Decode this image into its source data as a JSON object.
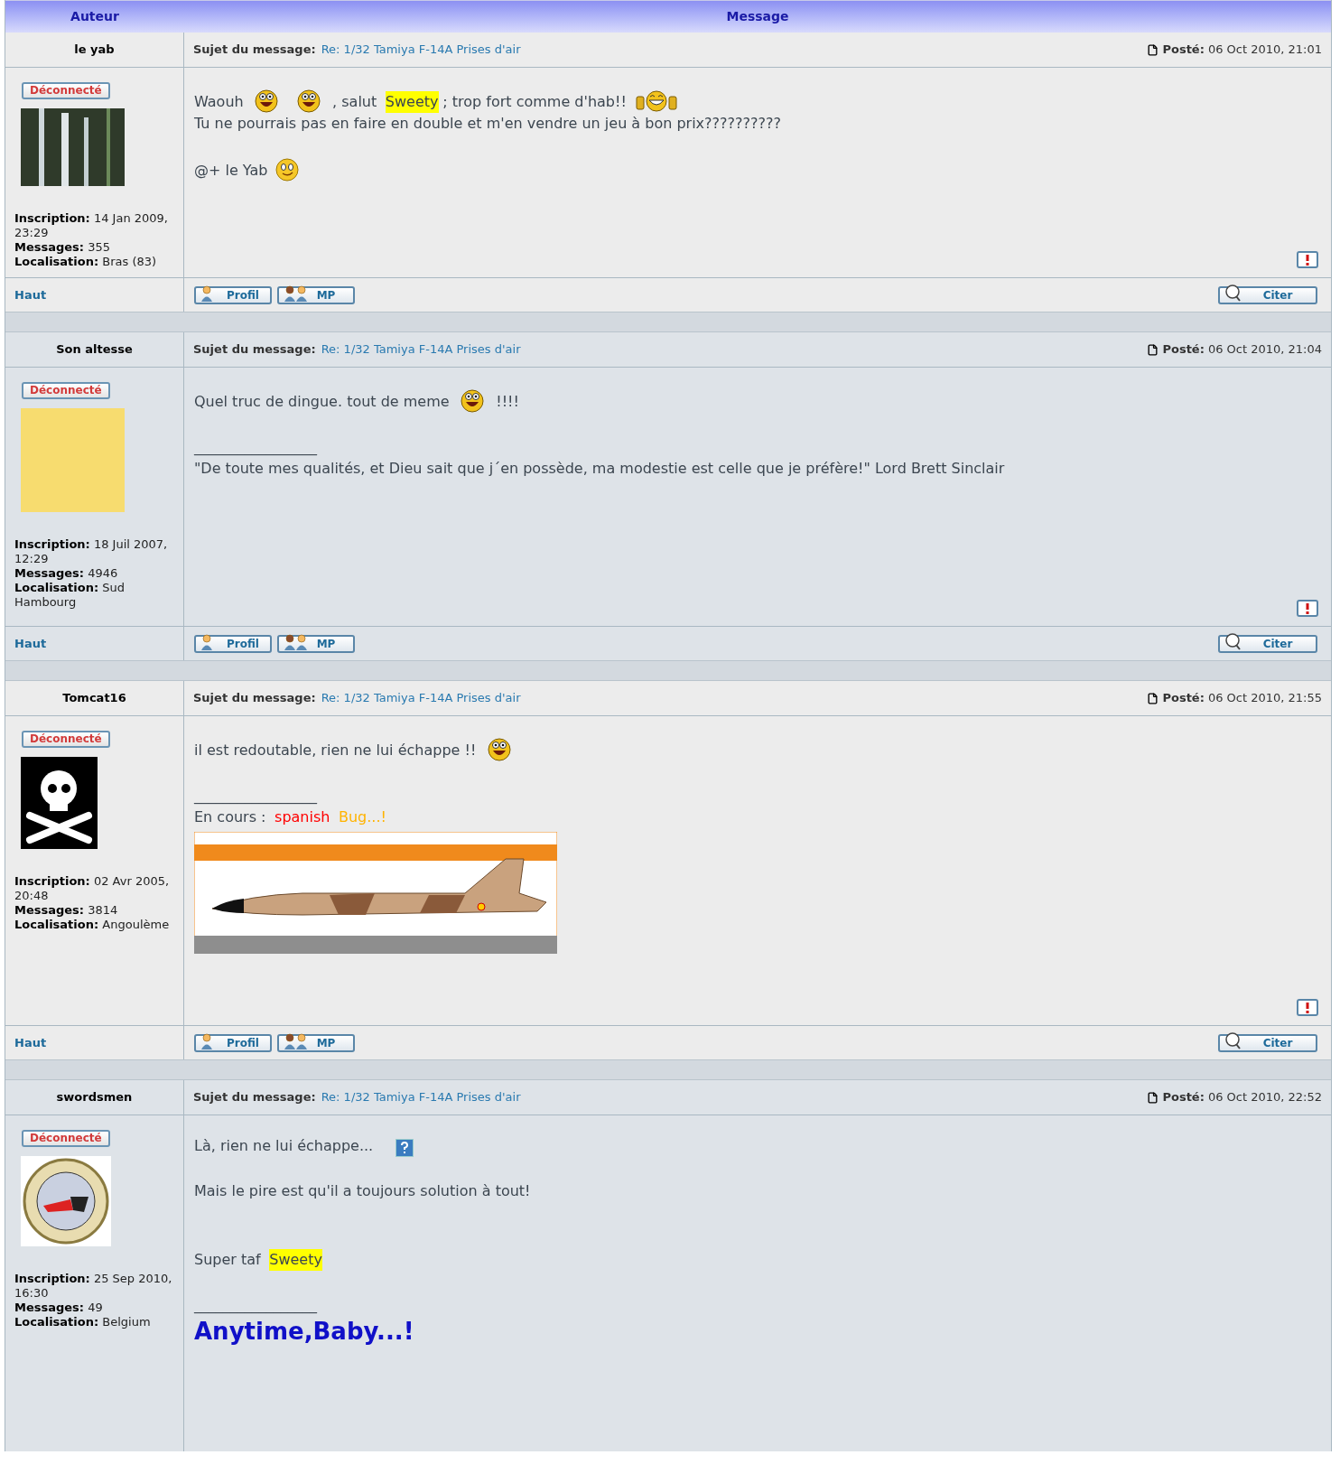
{
  "header": {
    "columns": [
      "Auteur",
      "Message"
    ]
  },
  "posts": [
    {
      "author": "le yab",
      "status": "Déconnecté",
      "avatar": {
        "kind": "waterfall"
      },
      "profile": [
        {
          "label": "Inscription:",
          "value": "14 Jan 2009, 23:29"
        },
        {
          "label": "Messages:",
          "value": "355"
        },
        {
          "label": "Localisation:",
          "value": "Bras (83)"
        }
      ],
      "subject_label": "Sujet du message:",
      "subject": "Re: 1/32 Tamiya F-14A Prises d'air",
      "posted_label": "Posté:",
      "posted": "06 Oct 2010, 21:01",
      "body": [
        {
          "kind": "text",
          "segments": [
            {
              "kind": "text",
              "text": "Waouh"
            },
            {
              "kind": "smiley"
            },
            {
              "kind": "smiley"
            },
            {
              "kind": "text",
              "text": ", salut"
            },
            {
              "kind": "highlight",
              "text": "Sweety"
            },
            {
              "kind": "text",
              "text": "; trop fort comme d'hab!!"
            },
            {
              "kind": "thumbs"
            }
          ]
        },
        {
          "kind": "text",
          "segments": [
            {
              "kind": "text",
              "text": "Tu ne pourrais pas en faire en double et m'en vendre un jeu à bon prix??????????"
            }
          ]
        },
        {
          "kind": "blank"
        },
        {
          "kind": "text",
          "segments": [
            {
              "kind": "text",
              "text": "@+ le Yab"
            },
            {
              "kind": "wink"
            }
          ]
        }
      ],
      "top_link": "Haut",
      "buttons": [
        {
          "kind": "profile",
          "label": "Profil"
        },
        {
          "kind": "pm",
          "label": "MP"
        },
        {
          "kind": "quote",
          "label": "Citer"
        }
      ]
    },
    {
      "author": "Son altesse",
      "status": "Déconnecté",
      "avatar": {
        "kind": "portrait"
      },
      "profile": [
        {
          "label": "Inscription:",
          "value": "18 Juil 2007, 12:29"
        },
        {
          "label": "Messages:",
          "value": "4946"
        },
        {
          "label": "Localisation:",
          "value": "Sud Hambourg"
        }
      ],
      "subject_label": "Sujet du message:",
      "subject": "Re: 1/32 Tamiya F-14A Prises d'air",
      "posted_label": "Posté:",
      "posted": "06 Oct 2010, 21:04",
      "body": [
        {
          "kind": "text",
          "segments": [
            {
              "kind": "text",
              "text": "Quel truc de dingue. tout de meme"
            },
            {
              "kind": "smiley"
            },
            {
              "kind": "text",
              "text": "!!!!"
            }
          ]
        },
        {
          "kind": "blank"
        },
        {
          "kind": "text",
          "segments": [
            {
              "kind": "text",
              "text": "_________________"
            }
          ]
        },
        {
          "kind": "text",
          "segments": [
            {
              "kind": "text",
              "text": "\"De toute mes qualités, et Dieu sait que j´en possède, ma modestie est celle que je préfère!\" Lord Brett Sinclair"
            }
          ]
        }
      ],
      "top_link": "Haut",
      "buttons": [
        {
          "kind": "profile",
          "label": "Profil"
        },
        {
          "kind": "pm",
          "label": "MP"
        },
        {
          "kind": "quote",
          "label": "Citer"
        }
      ]
    },
    {
      "author": "Tomcat16",
      "status": "Déconnecté",
      "avatar": {
        "kind": "skull"
      },
      "profile": [
        {
          "label": "Inscription:",
          "value": "02 Avr 2005, 20:48"
        },
        {
          "label": "Messages:",
          "value": "3814"
        },
        {
          "label": "Localisation:",
          "value": "Angoulème"
        }
      ],
      "subject_label": "Sujet du message:",
      "subject": "Re: 1/32 Tamiya F-14A Prises d'air",
      "posted_label": "Posté:",
      "posted": "06 Oct 2010, 21:55",
      "body": [
        {
          "kind": "text",
          "segments": [
            {
              "kind": "text",
              "text": "il est redoutable, rien ne lui échappe !!"
            },
            {
              "kind": "smiley"
            }
          ]
        },
        {
          "kind": "blank"
        },
        {
          "kind": "text",
          "segments": [
            {
              "kind": "text",
              "text": "_________________"
            }
          ]
        },
        {
          "kind": "text",
          "segments": [
            {
              "kind": "text",
              "text": "En cours :"
            },
            {
              "kind": "colored",
              "text": "spanish",
              "color": "#ff0000"
            },
            {
              "kind": "colored",
              "text": "Bug...!",
              "color": "#ffb300"
            }
          ]
        },
        {
          "kind": "banner"
        }
      ],
      "top_link": "Haut",
      "buttons": [
        {
          "kind": "profile",
          "label": "Profil"
        },
        {
          "kind": "pm",
          "label": "MP"
        },
        {
          "kind": "quote",
          "label": "Citer"
        }
      ]
    },
    {
      "author": "swordsmen",
      "status": "Déconnecté",
      "avatar": {
        "kind": "emblem"
      },
      "profile": [
        {
          "label": "Inscription:",
          "value": "25 Sep 2010, 16:30"
        },
        {
          "label": "Messages:",
          "value": "49"
        },
        {
          "label": "Localisation:",
          "value": "Belgium"
        }
      ],
      "subject_label": "Sujet du message:",
      "subject": "Re: 1/32 Tamiya F-14A Prises d'air",
      "posted_label": "Posté:",
      "posted": "06 Oct 2010, 22:52",
      "body": [
        {
          "kind": "text",
          "segments": [
            {
              "kind": "text",
              "text": "Là, rien ne lui échappe..."
            },
            {
              "kind": "help"
            }
          ]
        },
        {
          "kind": "blank"
        },
        {
          "kind": "text",
          "segments": [
            {
              "kind": "text",
              "text": "Mais le pire est qu'il a toujours solution à tout!"
            }
          ]
        },
        {
          "kind": "blank"
        },
        {
          "kind": "blank"
        },
        {
          "kind": "text",
          "segments": [
            {
              "kind": "text",
              "text": "Super taf"
            },
            {
              "kind": "highlight",
              "text": "Sweety"
            }
          ]
        },
        {
          "kind": "blank"
        },
        {
          "kind": "text",
          "segments": [
            {
              "kind": "text",
              "text": "_________________"
            }
          ]
        },
        {
          "kind": "headline",
          "text": "Anytime,Baby...!"
        }
      ]
    }
  ]
}
